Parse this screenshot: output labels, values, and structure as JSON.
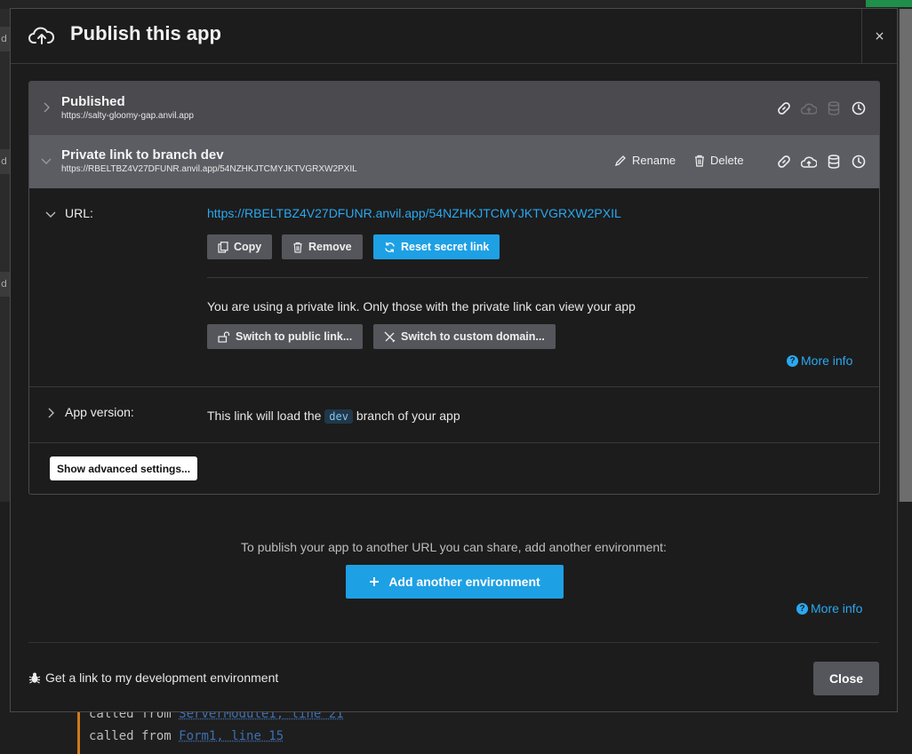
{
  "modal": {
    "title": "Publish this app",
    "close_x": "×"
  },
  "environments": [
    {
      "name": "Published",
      "url": "https://salty-gloomy-gap.anvil.app"
    },
    {
      "name": "Private link to branch dev",
      "url": "https://RBELTBZ4V27DFUNR.anvil.app/54NZHKJTCMYJKTVGRXW2PXIL",
      "rename_label": "Rename",
      "delete_label": "Delete"
    }
  ],
  "detail": {
    "url_label": "URL:",
    "url_value": "https://RBELTBZ4V27DFUNR.anvil.app/54NZHKJTCMYJKTVGRXW2PXIL",
    "copy_label": "Copy",
    "remove_label": "Remove",
    "reset_label": "Reset secret link",
    "private_note": "You are using a private link. Only those with the private link can view your app",
    "switch_public_label": "Switch to public link...",
    "switch_custom_label": "Switch to custom domain...",
    "more_info_label": "More info",
    "app_version_label": "App version:",
    "app_version_pre": "This link will load the",
    "app_version_branch": "dev",
    "app_version_post": "branch of your app",
    "advanced_label": "Show advanced settings..."
  },
  "footer": {
    "publish_note": "To publish your app to another URL you can share, add another environment:",
    "add_env_label": "Add another environment",
    "more_info_label": "More info",
    "dev_link_label": "Get a link to my development environment",
    "close_label": "Close"
  },
  "background": {
    "code_line_1_kw": "called from ",
    "code_line_1_link": "ServerModule1, line 21",
    "code_line_2_kw": "called from ",
    "code_line_2_link": "Form1, line 15",
    "tab_letters": [
      "d",
      "d",
      "d"
    ]
  },
  "colors": {
    "accent": "#1ea0e4",
    "link": "#2aa8f0",
    "modal_bg": "#1c1c1c"
  }
}
